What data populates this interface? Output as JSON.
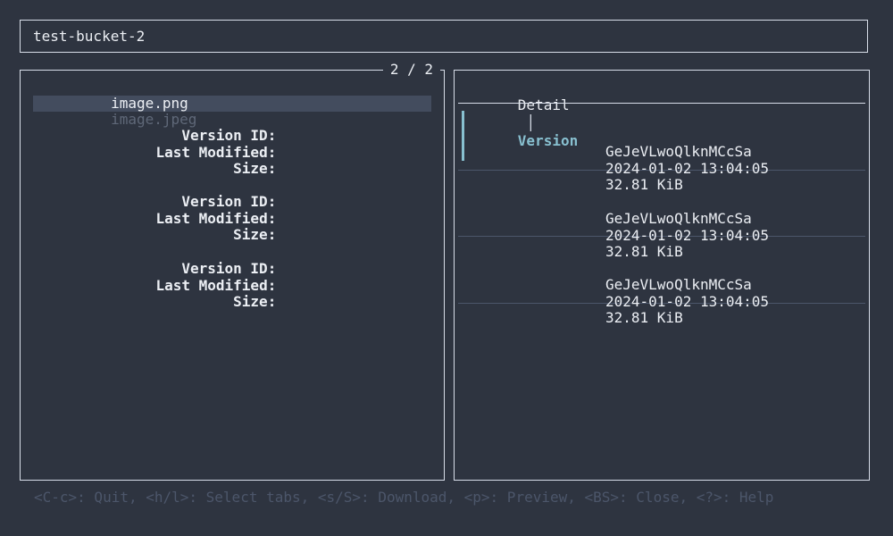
{
  "header": {
    "bucket_name": "test-bucket-2"
  },
  "object_list": {
    "counter": "2 / 2",
    "items": [
      {
        "name": "image.png"
      },
      {
        "name": "image.jpeg"
      }
    ]
  },
  "detail_pane": {
    "tabs": [
      {
        "label": "Detail"
      },
      {
        "label": "Version"
      }
    ],
    "tab_separator": "│",
    "field_labels": {
      "version_id": "Version ID:",
      "last_modified": "Last Modified:",
      "size": "Size:"
    },
    "versions": [
      {
        "version_id": "GeJeVLwoQlknMCcSa",
        "last_modified": "2024-01-02 13:04:05",
        "size": "32.81 KiB"
      },
      {
        "version_id": "GeJeVLwoQlknMCcSa",
        "last_modified": "2024-01-02 13:04:05",
        "size": "32.81 KiB"
      },
      {
        "version_id": "GeJeVLwoQlknMCcSa",
        "last_modified": "2024-01-02 13:04:05",
        "size": "32.81 KiB"
      }
    ]
  },
  "footer": {
    "help_text": "<C-c>: Quit, <h/l>: Select tabs, <s/S>: Download, <p>: Preview, <BS>: Close, <?>: Help"
  },
  "colors": {
    "background": "#2e3440",
    "border": "#d8dee9",
    "accent": "#88c0d0",
    "selection": "#434c5e",
    "muted": "#4c566a"
  }
}
